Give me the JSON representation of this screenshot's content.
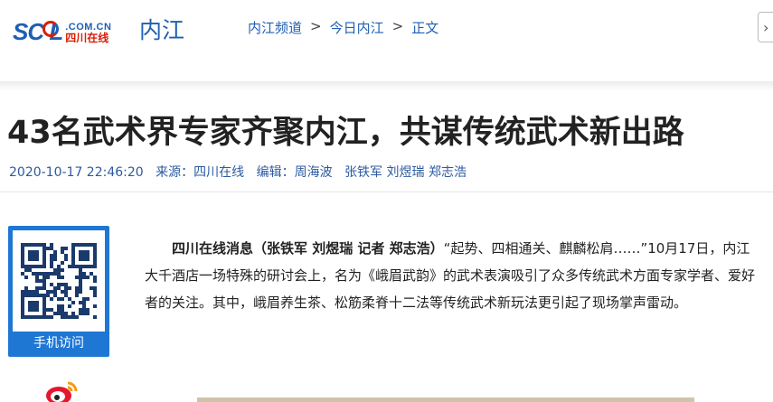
{
  "header": {
    "logo_main": "SC L",
    "logo_domain": ".COM.CN",
    "logo_cn": "四川在线",
    "channel": "内江",
    "breadcrumb": [
      "内江频道",
      "今日内江",
      "正文"
    ],
    "breadcrumb_sep": ">",
    "search_chevron": "›"
  },
  "article": {
    "title": "43名武术界专家齐聚内江，共谋传统武术新出路",
    "datetime": "2020-10-17 22:46:20",
    "source": "来源：四川在线",
    "editor": "编辑：周海波",
    "authors": "张铁军 刘煜瑞 郑志浩",
    "lead": "四川在线消息（张铁军 刘煜瑞 记者 郑志浩）",
    "body": "“起势、四相通关、麒麟松肩……”10月17日，内江大千酒店一场特殊的研讨会上，名为《峨眉武韵》的武术表演吸引了众多传统武术方面专家学者、爱好者的关注。其中，峨眉养生茶、松筋柔脊十二法等传统武术新玩法更引起了现场掌声雷动。"
  },
  "sidebar": {
    "qr_label": "手机访问",
    "weibo_icon": "weibo-icon"
  },
  "colors": {
    "brand_blue": "#1f5fb3",
    "brand_red": "#d81e06",
    "qr_blue": "#1f77d4",
    "meta_blue": "#2c5aa0"
  }
}
